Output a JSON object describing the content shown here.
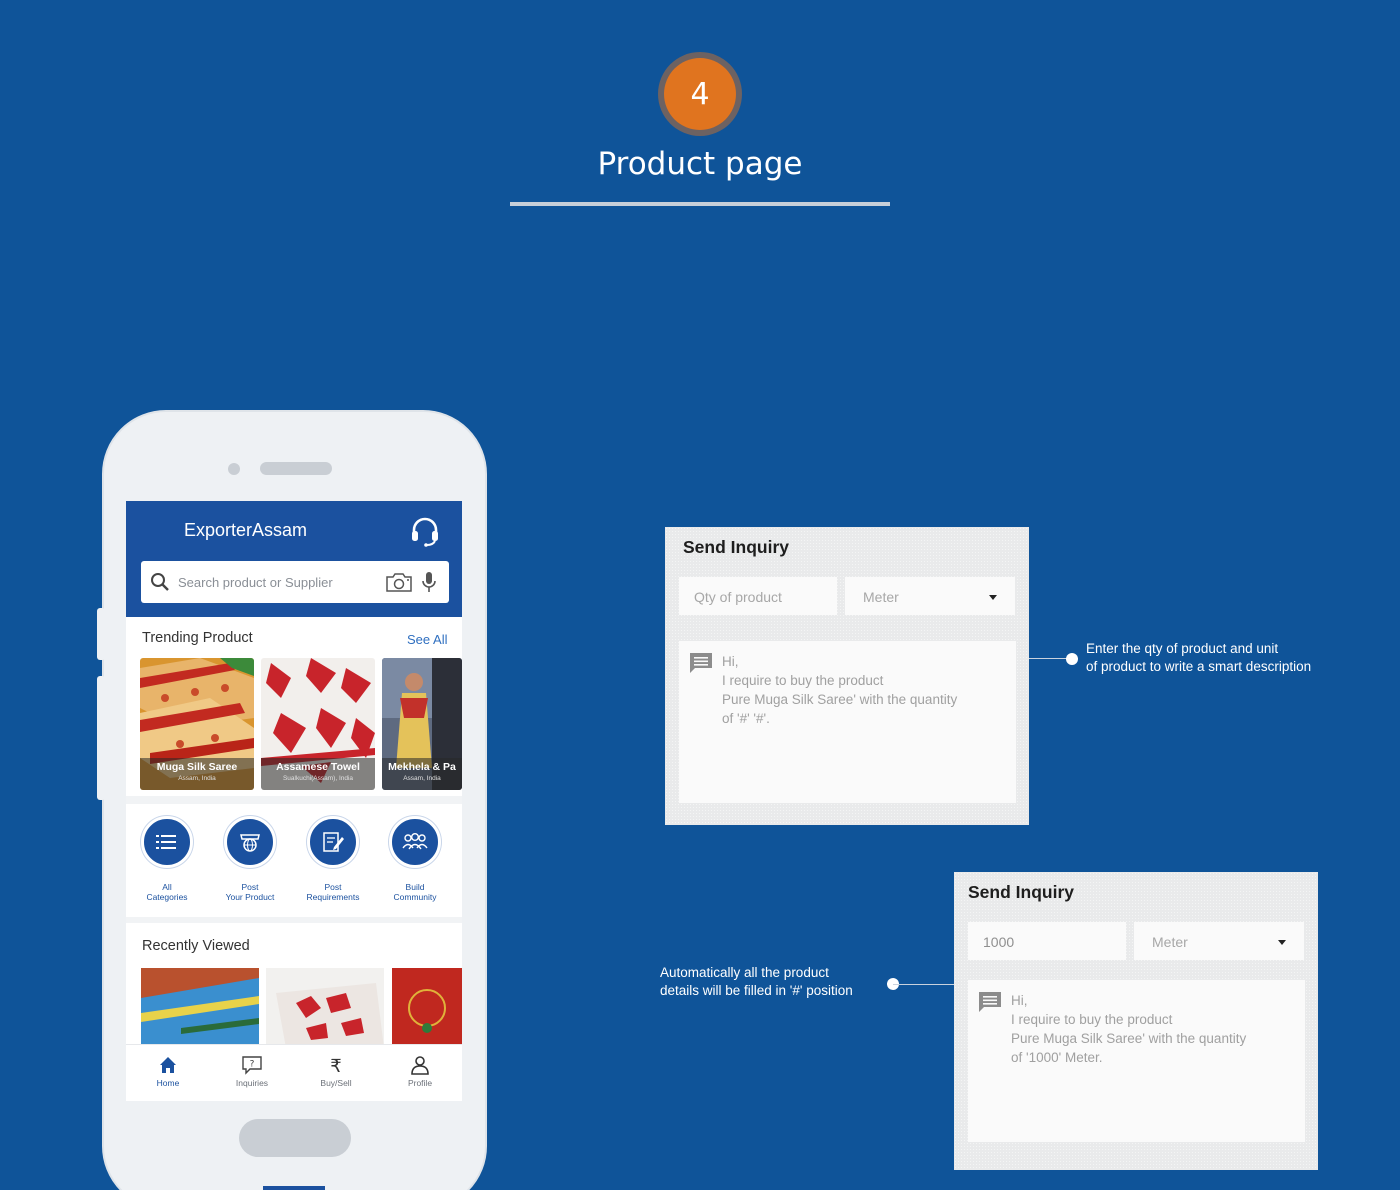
{
  "step": {
    "number": "4",
    "title": "Product page"
  },
  "app": {
    "name": "ExporterAssam",
    "search_placeholder": "Search product or Supplier",
    "trending": {
      "title": "Trending Product",
      "see_all": "See All",
      "products": [
        {
          "name": "Muga Silk Saree",
          "location": "Assam, India"
        },
        {
          "name": "Assamese Towel",
          "location": "Sualkuchi(Assam), India"
        },
        {
          "name": "Mekhela & Pa",
          "location": "Assam, India"
        }
      ]
    },
    "actions": [
      {
        "line1": "All",
        "line2": "Categories",
        "icon": "list-icon"
      },
      {
        "line1": "Post",
        "line2": "Your Product",
        "icon": "shop-globe-icon"
      },
      {
        "line1": "Post",
        "line2": "Requirements",
        "icon": "edit-document-icon"
      },
      {
        "line1": "Build",
        "line2": "Community",
        "icon": "group-icon"
      }
    ],
    "recently_viewed": {
      "title": "Recently Viewed"
    },
    "bottom_nav": [
      {
        "label": "Home",
        "icon": "home-icon",
        "active": true
      },
      {
        "label": "Inquiries",
        "icon": "question-chat-icon",
        "active": false
      },
      {
        "label": "Buy/Sell",
        "icon": "rupee-icon",
        "active": false
      },
      {
        "label": "Profile",
        "icon": "person-icon",
        "active": false
      }
    ]
  },
  "inquiry_empty": {
    "title": "Send Inquiry",
    "qty_placeholder": "Qty of product",
    "unit": "Meter",
    "message_lines": [
      "Hi,",
      "I require to buy the product",
      "Pure Muga Silk Saree' with the quantity",
      "of '#' '#'."
    ]
  },
  "inquiry_filled": {
    "title": "Send Inquiry",
    "qty_value": "1000",
    "unit": "Meter",
    "message_lines": [
      "Hi,",
      "I require to buy the product",
      "Pure Muga Silk Saree' with the quantity",
      "of '1000' Meter."
    ]
  },
  "callouts": {
    "first": [
      "Enter the qty of product and unit",
      "of product to write a smart description"
    ],
    "second": [
      "Automatically all the product",
      "details will be filled in '#' position"
    ]
  },
  "colors": {
    "background": "#0f5499",
    "badge": "#e0741f",
    "app_primary": "#1b519f",
    "link": "#2f6fc0"
  }
}
